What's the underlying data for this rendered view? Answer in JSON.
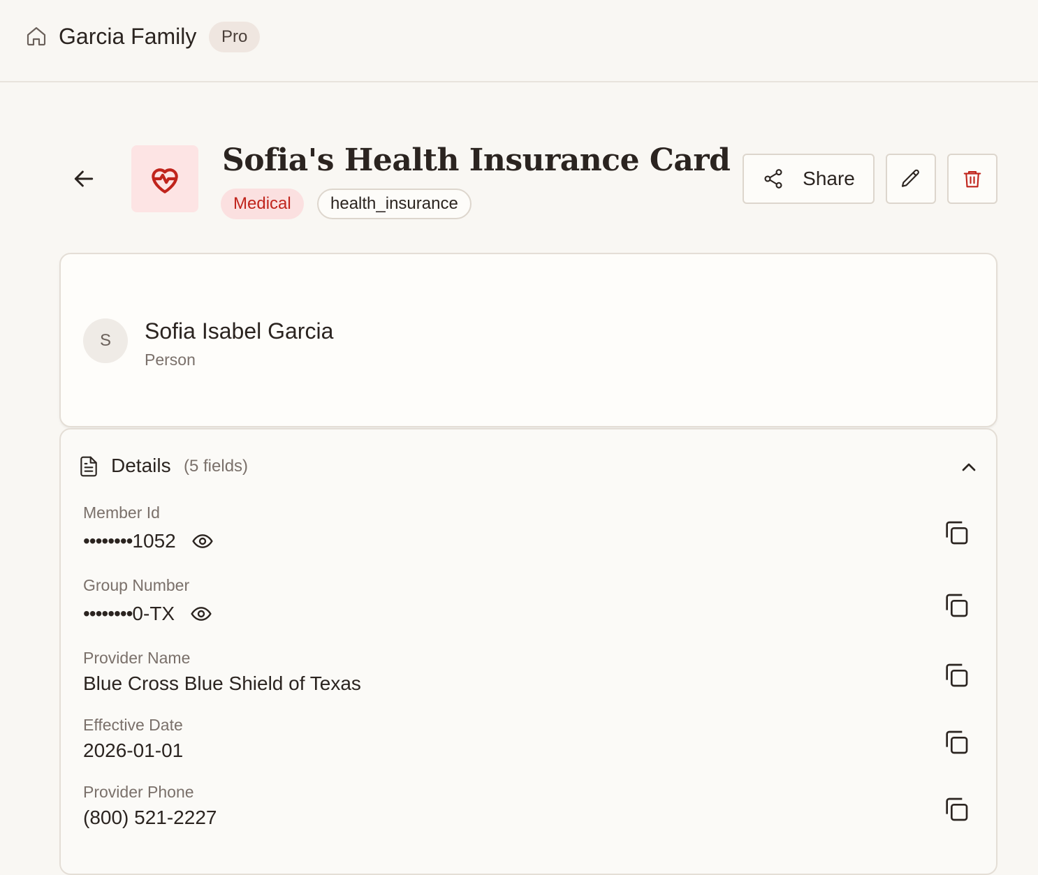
{
  "header": {
    "family_name": "Garcia Family",
    "plan_badge": "Pro"
  },
  "document": {
    "title": "Sofia's Health Insurance Card",
    "category_tag": "Medical",
    "type_tag": "health_insurance",
    "icon": "heart-pulse-icon",
    "accent_color": "#c0241c"
  },
  "actions": {
    "share_label": "Share"
  },
  "person": {
    "initial": "S",
    "name": "Sofia Isabel Garcia",
    "type": "Person"
  },
  "details": {
    "title": "Details",
    "count": "(5 fields)",
    "fields": [
      {
        "label": "Member Id",
        "dots": "••••••••",
        "value": "1052",
        "masked": true
      },
      {
        "label": "Group Number",
        "dots": "••••••••",
        "value": "0-TX",
        "masked": true
      },
      {
        "label": "Provider Name",
        "value": "Blue Cross Blue Shield of Texas",
        "masked": false
      },
      {
        "label": "Effective Date",
        "value": "2026-01-01",
        "masked": false
      },
      {
        "label": "Provider Phone",
        "value": "(800) 521-2227",
        "masked": false
      }
    ]
  }
}
